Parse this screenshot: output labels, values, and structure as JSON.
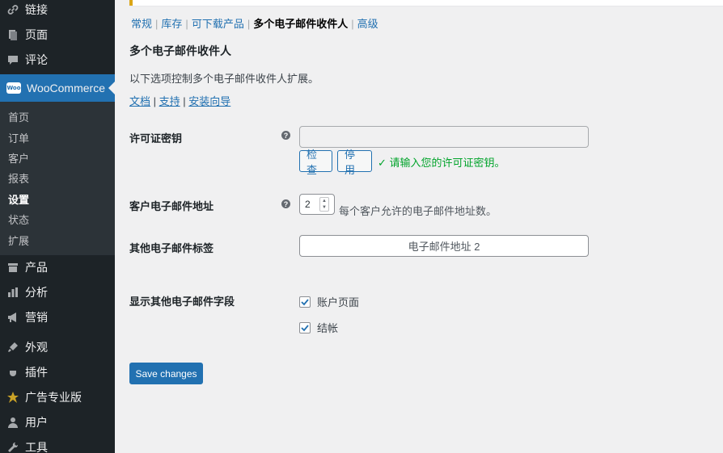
{
  "sidebar": {
    "top_items": [
      {
        "label": "链接",
        "icon": "link-icon"
      },
      {
        "label": "页面",
        "icon": "pages-icon"
      },
      {
        "label": "评论",
        "icon": "comments-icon"
      }
    ],
    "current": {
      "label": "WooCommerce",
      "icon": "woocommerce-icon",
      "logo_text": "Woo"
    },
    "submenu": [
      "首页",
      "订单",
      "客户",
      "报表",
      "设置",
      "状态",
      "扩展"
    ],
    "active_sub": "设置",
    "lower_items": [
      {
        "label": "产品",
        "icon": "products-icon"
      },
      {
        "label": "分析",
        "icon": "analytics-icon"
      },
      {
        "label": "营销",
        "icon": "megaphone-icon"
      }
    ],
    "bottom_items": [
      {
        "label": "外观",
        "icon": "appearance-icon"
      },
      {
        "label": "插件",
        "icon": "plugins-icon"
      },
      {
        "label": "广告专业版",
        "icon": "star-icon"
      },
      {
        "label": "用户",
        "icon": "users-icon"
      },
      {
        "label": "工具",
        "icon": "tools-icon"
      }
    ]
  },
  "tabs": {
    "general": "常规",
    "inventory": "库存",
    "downloadable": "可下载产品",
    "current": "多个电子邮件收件人",
    "advanced": "高级"
  },
  "section": {
    "title": "多个电子邮件收件人",
    "description": "以下选项控制多个电子邮件收件人扩展。",
    "links": {
      "docs": "文档",
      "support": "支持",
      "setup": "安装向导"
    }
  },
  "fields": {
    "license": {
      "label": "许可证密钥",
      "value": "",
      "check_btn": "检查",
      "deactivate_btn": "停用",
      "status": "✓ 请输入您的许可证密钥。"
    },
    "customer_emails": {
      "label": "客户电子邮件地址",
      "value": "2",
      "description": "每个客户允许的电子邮件地址数。"
    },
    "other_label": {
      "label": "其他电子邮件标签",
      "value": "电子邮件地址 2"
    },
    "display_fields": {
      "label": "显示其他电子邮件字段",
      "options": [
        {
          "label": "账户页面",
          "checked": true
        },
        {
          "label": "结帐",
          "checked": true
        }
      ]
    }
  },
  "save_button": "Save changes",
  "colors": {
    "accent": "#2271b1",
    "sidebar": "#1d2327",
    "success": "#00a32a"
  }
}
